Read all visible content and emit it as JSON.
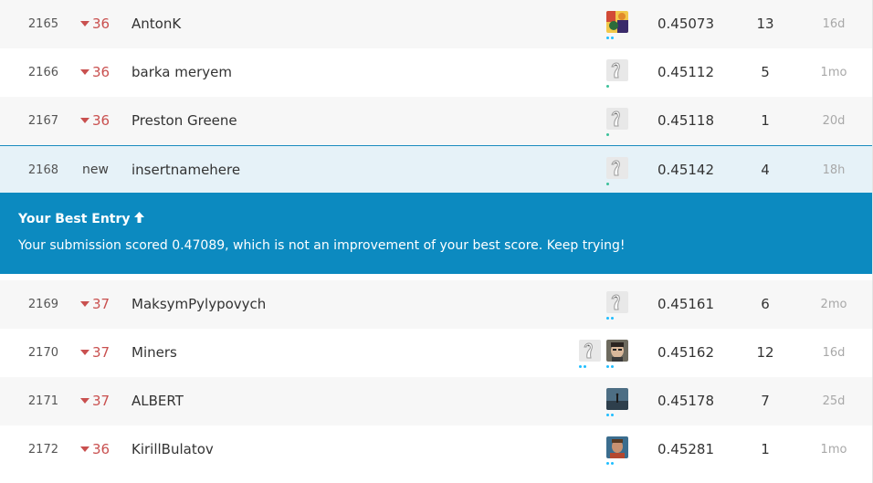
{
  "rows_top": [
    {
      "rank": "2165",
      "change": "36",
      "change_dir": "down",
      "team": "AntonK",
      "avatars": [
        "photo-colorful"
      ],
      "dots": [
        "blue",
        "blue"
      ],
      "score": "0.45073",
      "entries": "13",
      "last": "16d"
    },
    {
      "rank": "2166",
      "change": "36",
      "change_dir": "down",
      "team": "barka meryem",
      "avatars": [
        "default-goose"
      ],
      "dots": [
        "green"
      ],
      "score": "0.45112",
      "entries": "5",
      "last": "1mo"
    },
    {
      "rank": "2167",
      "change": "36",
      "change_dir": "down",
      "team": "Preston Greene",
      "avatars": [
        "default-goose"
      ],
      "dots": [
        "green"
      ],
      "score": "0.45118",
      "entries": "1",
      "last": "20d"
    },
    {
      "rank": "2168",
      "change": "new",
      "change_dir": "new",
      "team": "insertnamehere",
      "avatars": [
        "default-goose"
      ],
      "dots": [
        "green"
      ],
      "score": "0.45142",
      "entries": "4",
      "last": "18h"
    }
  ],
  "banner": {
    "title": "Your Best Entry",
    "arrow_icon": "arrow-up-icon",
    "message": "Your submission scored 0.47089, which is not an improvement of your best score. Keep trying!"
  },
  "rows_bottom": [
    {
      "rank": "2169",
      "change": "37",
      "change_dir": "down",
      "team": "MaksymPylypovych",
      "avatars": [
        "default-goose"
      ],
      "dots": [
        "blue",
        "blue"
      ],
      "score": "0.45161",
      "entries": "6",
      "last": "2mo"
    },
    {
      "rank": "2170",
      "change": "37",
      "change_dir": "down",
      "team": "Miners",
      "avatars": [
        "default-goose",
        "photo-face"
      ],
      "dots": [
        "blue",
        "blue"
      ],
      "score": "0.45162",
      "entries": "12",
      "last": "16d"
    },
    {
      "rank": "2171",
      "change": "37",
      "change_dir": "down",
      "team": "ALBERT",
      "avatars": [
        "photo-silhouette"
      ],
      "dots": [
        "blue",
        "blue"
      ],
      "score": "0.45178",
      "entries": "7",
      "last": "25d"
    },
    {
      "rank": "2172",
      "change": "36",
      "change_dir": "down",
      "team": "KirillBulatov",
      "avatars": [
        "photo-portrait"
      ],
      "dots": [
        "blue",
        "blue"
      ],
      "score": "0.45281",
      "entries": "1",
      "last": "1mo"
    }
  ],
  "colors": {
    "accent": "#0c8ac0",
    "rank_down": "#c9504f",
    "row_highlight": "#e6f2f8",
    "tier_blue": "#20beff",
    "tier_green": "#3cc19a"
  }
}
